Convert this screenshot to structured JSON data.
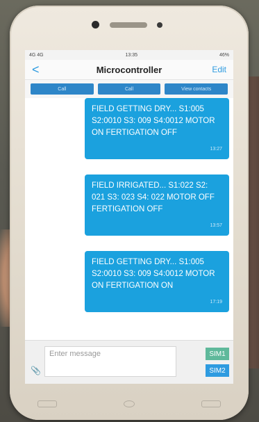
{
  "status_bar": {
    "left": "4G 4G",
    "time": "13:35",
    "right": "46%"
  },
  "header": {
    "back": "<",
    "title": "Microcontroller",
    "edit": "Edit"
  },
  "actions": [
    {
      "label": "Call"
    },
    {
      "label": "Call"
    },
    {
      "label": "View contacts"
    }
  ],
  "messages": [
    {
      "text": "FIELD GETTING DRY... S1:005 S2:0010 S3: 009 S4:0012 MOTOR ON FERTIGATION OFF",
      "time": "13:27"
    },
    {
      "text": "FIELD IRRIGATED... S1:022 S2: 021 S3: 023 S4: 022 MOTOR OFF FERTIGATION OFF",
      "time": "13:57"
    },
    {
      "text": "FIELD GETTING DRY... S1:005 S2:0010 S3: 009 S4:0012 MOTOR ON FERTIGATION ON",
      "time": "17:19"
    }
  ],
  "composer": {
    "placeholder": "Enter message",
    "sim1": "SIM1",
    "sim2": "SIM2"
  },
  "colors": {
    "accent": "#1ba1de",
    "sim1": "#5fb99b",
    "sim2": "#2e9be0"
  }
}
